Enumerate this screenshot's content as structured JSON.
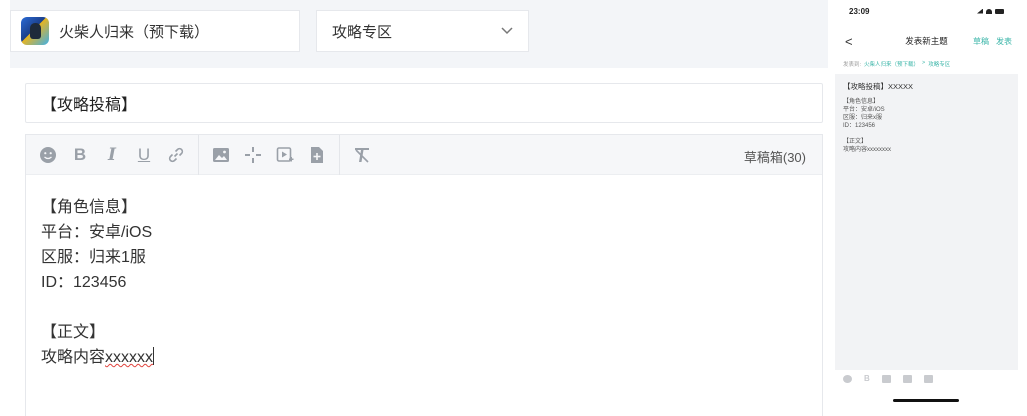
{
  "header": {
    "game_name": "火柴人归来（预下载）",
    "category": "攻略专区"
  },
  "title_input": {
    "value": "【攻略投稿】"
  },
  "toolbar": {
    "bold_label": "B",
    "italic_label": "I",
    "underline_label": "U",
    "draft_label": "草稿箱(30)"
  },
  "editor": {
    "lines": [
      "【角色信息】",
      "平台：安卓/iOS",
      "区服：归来1服",
      "ID：123456",
      "",
      "【正文】",
      "攻略内容"
    ],
    "last_line_tail": "xxxxxx"
  },
  "phone": {
    "time": "23:09",
    "back_glyph": "<",
    "nav_title": "发表新主题",
    "draft_action": "草稿",
    "publish_action": "发表",
    "post_to_label": "发表到:",
    "post_to_game": "火柴人归来（预下载）",
    "post_to_sep": ">",
    "post_to_category": "攻略专区",
    "preview_title": "【攻略投稿】XXXXX",
    "preview_lines": [
      "【角色信息】",
      "平台：安卓/iOS",
      "区服：归来x服",
      "ID：123456",
      "",
      "【正文】",
      "攻略内容xxxxxxxx"
    ],
    "bold_label": "B"
  },
  "icons": {
    "emoji": "emoji-icon",
    "bold": "bold-icon",
    "italic": "italic-icon",
    "underline": "underline-icon",
    "link": "link-icon",
    "image": "image-icon",
    "move": "move-icon",
    "video": "video-icon",
    "attachment": "attachment-icon",
    "clear_format": "clear-format-icon",
    "chevron": "chevron-down-icon"
  },
  "colors": {
    "accent": "#3ab5a8",
    "toolbar_bg": "#f6f7f9",
    "spellcheck": "#e0433d"
  }
}
